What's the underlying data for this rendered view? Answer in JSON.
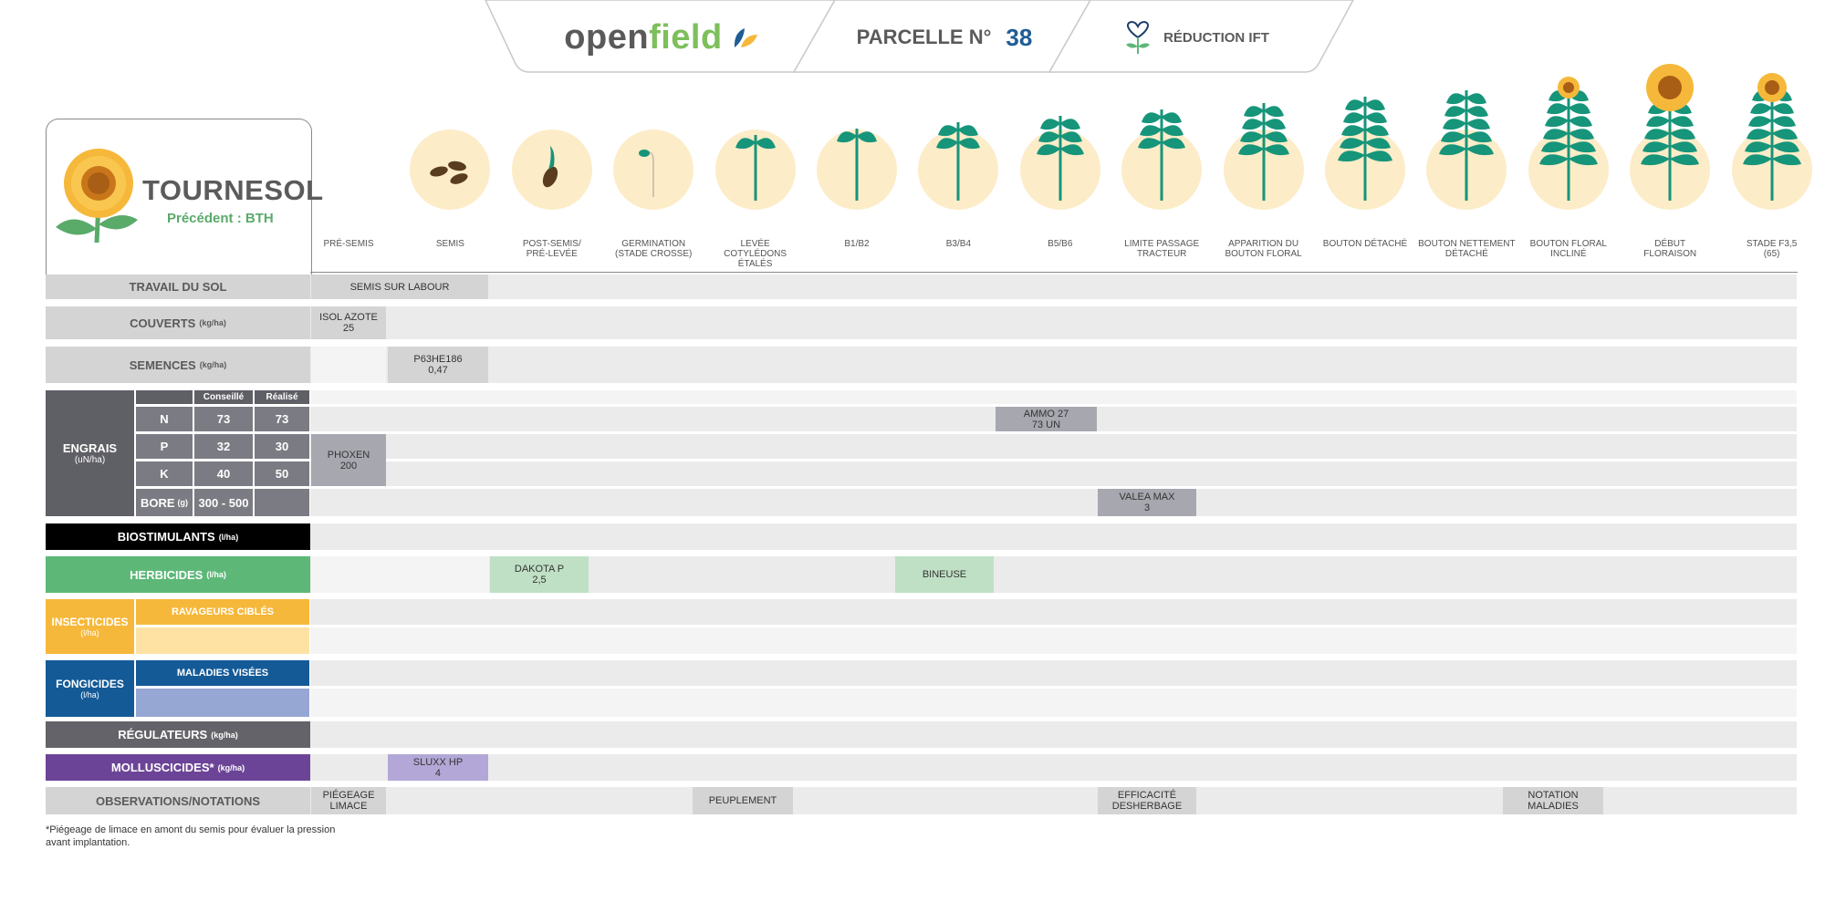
{
  "header": {
    "brand_open": "open",
    "brand_field": "field",
    "parcel_label": "PARCELLE N°",
    "parcel_number": "38",
    "ift_label": "RÉDUCTION IFT"
  },
  "crop": {
    "name": "TOURNESOL",
    "previous": "Précédent : BTH"
  },
  "stages": [
    {
      "label": "PRÉ-SEMIS"
    },
    {
      "label": "SEMIS"
    },
    {
      "label": "POST-SEMIS/\nPRÉ-LEVÉE"
    },
    {
      "label": "GERMINATION\n(STADE CROSSE)"
    },
    {
      "label": "LEVÉE\nCOTYLÉDONS\nÉTALÉS"
    },
    {
      "label": "B1/B2"
    },
    {
      "label": "B3/B4"
    },
    {
      "label": "B5/B6"
    },
    {
      "label": "LIMITE PASSAGE\nTRACTEUR"
    },
    {
      "label": "APPARITION DU\nBOUTON FLORAL"
    },
    {
      "label": "BOUTON DÉTACHÉ"
    },
    {
      "label": "BOUTON NETTEMENT\nDÉTACHÉ"
    },
    {
      "label": "BOUTON FLORAL\nINCLINÉ"
    },
    {
      "label": "DÉBUT\nFLORAISON"
    },
    {
      "label": "STADE F3,5\n(65)"
    }
  ],
  "rows": {
    "travail_sol": {
      "label": "TRAVAIL DU SOL"
    },
    "couverts": {
      "label": "COUVERTS",
      "unit": "(kg/ha)"
    },
    "semences": {
      "label": "SEMENCES",
      "unit": "(kg/ha)"
    },
    "engrais": {
      "label": "ENGRAIS",
      "unit": "(uN/ha)"
    },
    "biostimulants": {
      "label": "BIOSTIMULANTS",
      "unit": "(l/ha)"
    },
    "herbicides": {
      "label": "HERBICIDES",
      "unit": "(l/ha)"
    },
    "insecticides": {
      "label": "INSECTICIDES",
      "unit": "(l/ha)",
      "sub": "RAVAGEURS CIBLÉS"
    },
    "fongicides": {
      "label": "FONGICIDES",
      "unit": "(l/ha)",
      "sub": "MALADIES VISÉES"
    },
    "regulateurs": {
      "label": "RÉGULATEURS",
      "unit": "(kg/ha)"
    },
    "molluscicides": {
      "label": "MOLLUSCICIDES*",
      "unit": "(kg/ha)"
    },
    "observations": {
      "label": "OBSERVATIONS/NOTATIONS"
    }
  },
  "engrais_table": {
    "col_conseille": "Conseillé",
    "col_realise": "Réalisé",
    "lines": [
      {
        "name": "N",
        "conseille": "73",
        "realise": "73"
      },
      {
        "name": "P",
        "conseille": "32",
        "realise": "30"
      },
      {
        "name": "K",
        "conseille": "40",
        "realise": "50"
      },
      {
        "name": "BORE",
        "unit": "(g)",
        "conseille": "300 - 500",
        "realise": ""
      }
    ]
  },
  "entries": {
    "semis_labour": "SEMIS SUR LABOUR",
    "isol_azote": "ISOL AZOTE\n25",
    "p63": "P63HE186\n0,47",
    "ammo": "AMMO 27\n73 uN",
    "phoxen": "PHOXEN\n200",
    "valea": "VALEA MAX\n3",
    "dakota": "DAKOTA P\n2,5",
    "bineuse": "BINEUSE",
    "sluxx": "SLUXX HP\n4",
    "piegeage": "PIÉGEAGE\nLIMACE",
    "peuplement": "PEUPLEMENT",
    "efficacite": "EFFICACITÉ\nDESHERBAGE",
    "notation": "NOTATION\nMALADIES"
  },
  "footnote": "*Piégeage de limace en amont du semis pour évaluer la pression avant implantation.",
  "colors": {
    "herbicides": "#5db878",
    "insecticides": "#f6b83a",
    "fongicides": "#145a97",
    "molluscicides": "#6c4497",
    "regulateurs": "#636369",
    "engrais": "#5f5f66",
    "biostimulants": "#000000"
  }
}
